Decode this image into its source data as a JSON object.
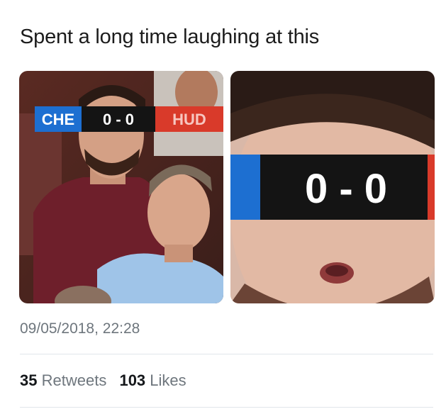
{
  "tweet": {
    "text": "Spent a long time laughing at this",
    "timestamp": "09/05/2018, 22:28"
  },
  "scoreboard": {
    "home": "CHE",
    "score": "0 - 0",
    "away": "HUD",
    "zoom_score": "0 - 0"
  },
  "stats": {
    "retweets_count": "35",
    "retweets_label": "Retweets",
    "likes_count": "103",
    "likes_label": "Likes"
  },
  "colors": {
    "che_blue": "#1d6fd1",
    "hud_red": "#d93a2a",
    "bar_black": "#141414"
  }
}
